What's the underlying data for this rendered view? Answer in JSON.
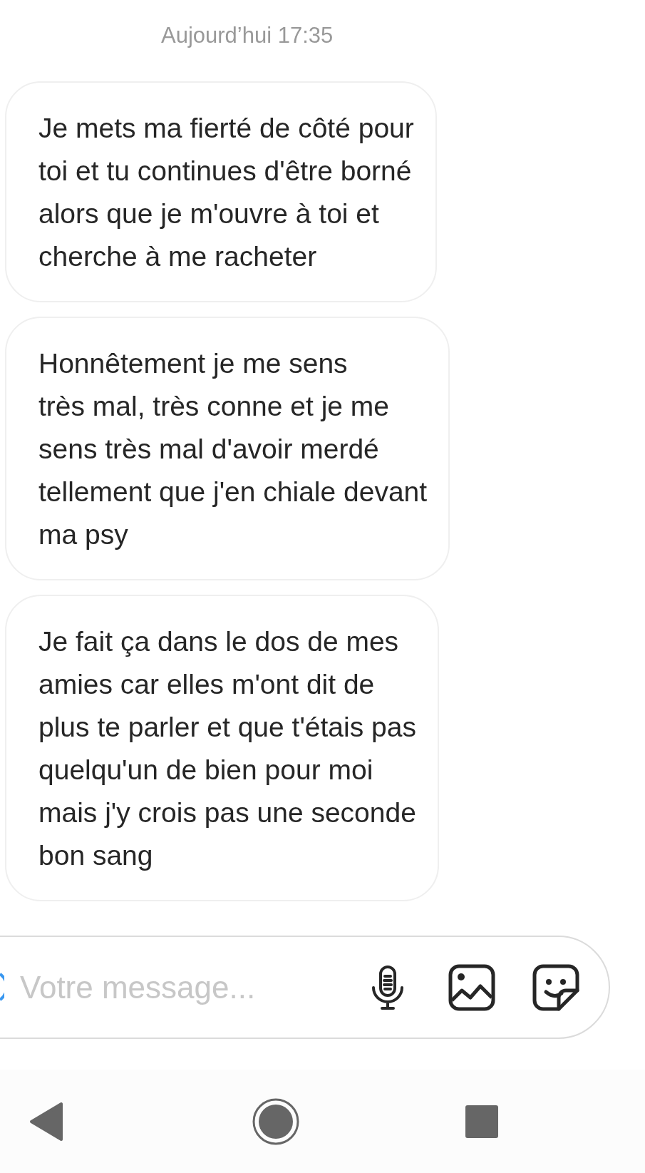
{
  "timestamp": "Aujourd’hui 17:35",
  "messages": [
    {
      "text": "Je mets ma fierté de côté pour\ntoi et tu continues d'être borné\nalors que je m'ouvre à toi et\ncherche à me racheter"
    },
    {
      "text": "Honnêtement je me sens\ntrès mal, très conne et je me\nsens très mal d'avoir merdé\ntellement que j'en chiale devant\nma psy"
    },
    {
      "text": "Je fait ça dans le dos de mes\namies car elles m'ont dit de\nplus te parler et que t'étais pas\nquelqu'un de bien pour moi\nmais j'y crois pas une seconde\nbon sang"
    }
  ],
  "composer": {
    "placeholder": "Votre message..."
  }
}
